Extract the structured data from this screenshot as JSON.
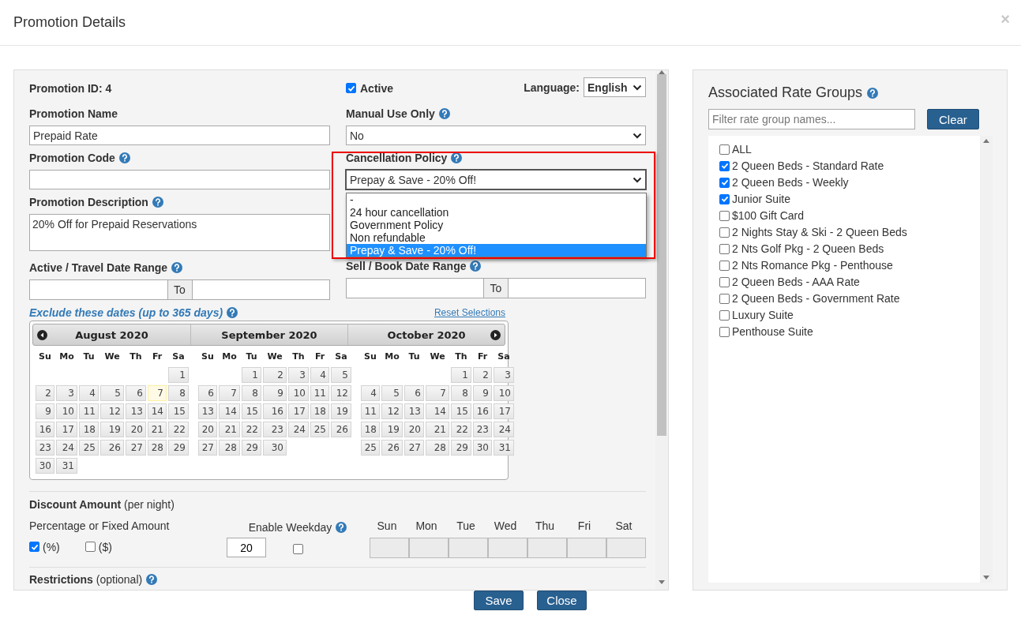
{
  "dialog": {
    "title": "Promotion Details",
    "close": "×"
  },
  "form": {
    "promotion_id": "Promotion ID: 4",
    "active": {
      "label": "Active",
      "checked": true
    },
    "language": {
      "label": "Language:",
      "value": "English"
    },
    "promotion_name": {
      "label": "Promotion Name",
      "value": "Prepaid Rate"
    },
    "manual_use_only": {
      "label": "Manual Use Only",
      "value": "No"
    },
    "promotion_code": {
      "label": "Promotion Code"
    },
    "cancellation_policy": {
      "label": "Cancellation Policy",
      "value": "Prepay & Save - 20% Off!",
      "expanded": true,
      "options": [
        {
          "label": "-",
          "selected": false
        },
        {
          "label": "24 hour cancellation",
          "selected": false
        },
        {
          "label": "Government Policy",
          "selected": false
        },
        {
          "label": "Non refundable",
          "selected": false
        },
        {
          "label": "Prepay & Save - 20% Off!",
          "selected": true
        }
      ]
    },
    "promotion_description": {
      "label": "Promotion Description",
      "value": "20% Off for Prepaid Reservations"
    },
    "travel_range": {
      "label": "Active / Travel Date Range",
      "to": "To"
    },
    "sell_range": {
      "label": "Sell / Book Date Range",
      "to": "To"
    },
    "exclude_label": "Exclude these dates (up to 365 days)",
    "reset_link": "Reset Selections"
  },
  "calendar": {
    "months": [
      {
        "title": "August 2020",
        "weekdays": [
          "Su",
          "Mo",
          "Tu",
          "We",
          "Th",
          "Fr",
          "Sa"
        ],
        "weeks": [
          {
            "kind": "first",
            "days": [
              "1"
            ]
          },
          {
            "kind": "week",
            "days": [
              "2",
              "3",
              "4",
              "5",
              "6",
              {
                "day": "7",
                "today": true
              },
              "8"
            ]
          },
          {
            "kind": "week",
            "days": [
              "9",
              "10",
              "11",
              "12",
              "13",
              "14",
              "15"
            ]
          },
          {
            "kind": "week",
            "days": [
              "16",
              "17",
              "18",
              "19",
              "20",
              "21",
              "22"
            ]
          },
          {
            "kind": "week",
            "days": [
              "23",
              "24",
              "25",
              "26",
              "27",
              "28",
              "29"
            ]
          },
          {
            "kind": "week",
            "days": [
              "30",
              "31"
            ]
          }
        ]
      },
      {
        "title": "September 2020",
        "weekdays": [
          "Su",
          "Mo",
          "Tu",
          "We",
          "Th",
          "Fr",
          "Sa"
        ],
        "weeks": [
          {
            "kind": "first",
            "days": [
              "1",
              "2",
              "3",
              "4",
              "5"
            ]
          },
          {
            "kind": "week",
            "days": [
              "6",
              "7",
              "8",
              "9",
              "10",
              "11",
              "12"
            ]
          },
          {
            "kind": "week",
            "days": [
              "13",
              "14",
              "15",
              "16",
              "17",
              "18",
              "19"
            ]
          },
          {
            "kind": "week",
            "days": [
              "20",
              "21",
              "22",
              "23",
              "24",
              "25",
              "26"
            ]
          },
          {
            "kind": "week",
            "days": [
              "27",
              "28",
              "29",
              "30"
            ]
          }
        ]
      },
      {
        "title": "October 2020",
        "weekdays": [
          "Su",
          "Mo",
          "Tu",
          "We",
          "Th",
          "Fr",
          "Sa"
        ],
        "weeks": [
          {
            "kind": "first",
            "days": [
              "1",
              "2",
              "3"
            ]
          },
          {
            "kind": "week",
            "days": [
              "4",
              "5",
              "6",
              "7",
              "8",
              "9",
              "10"
            ]
          },
          {
            "kind": "week",
            "days": [
              "11",
              "12",
              "13",
              "14",
              "15",
              "16",
              "17"
            ]
          },
          {
            "kind": "week",
            "days": [
              "18",
              "19",
              "20",
              "21",
              "22",
              "23",
              "24"
            ]
          },
          {
            "kind": "week",
            "days": [
              "25",
              "26",
              "27",
              "28",
              "29",
              "30",
              "31"
            ]
          }
        ]
      }
    ]
  },
  "discount": {
    "title": "Discount Amount",
    "note": "(per night)",
    "type_label": "Percentage or Fixed Amount",
    "types": [
      {
        "label": "(%)",
        "checked": true
      },
      {
        "label": "($)",
        "checked": false
      }
    ],
    "amount": "20",
    "weekday_label": "Enable Weekday",
    "weekday_enabled": false,
    "days": [
      "Sun",
      "Mon",
      "Tue",
      "Wed",
      "Thu",
      "Fri",
      "Sat"
    ]
  },
  "restrictions": {
    "title": "Restrictions",
    "note": "(optional)"
  },
  "rate_groups": {
    "title": "Associated Rate Groups",
    "filter_placeholder": "Filter rate group names...",
    "clear": "Clear",
    "items": [
      {
        "label": "ALL",
        "checked": false
      },
      {
        "label": "2 Queen Beds - Standard Rate",
        "checked": true
      },
      {
        "label": "2 Queen Beds - Weekly",
        "checked": true
      },
      {
        "label": "Junior Suite",
        "checked": true
      },
      {
        "label": "$100 Gift Card",
        "checked": false
      },
      {
        "label": "2 Nights Stay & Ski - 2 Queen Beds",
        "checked": false
      },
      {
        "label": "2 Nts Golf Pkg - 2 Queen Beds",
        "checked": false
      },
      {
        "label": "2 Nts Romance Pkg - Penthouse",
        "checked": false
      },
      {
        "label": "2 Queen Beds - AAA Rate",
        "checked": false
      },
      {
        "label": "2 Queen Beds - Government Rate",
        "checked": false
      },
      {
        "label": "Luxury Suite",
        "checked": false
      },
      {
        "label": "Penthouse Suite",
        "checked": false
      }
    ]
  },
  "buttons": [
    "Save",
    "Close"
  ]
}
